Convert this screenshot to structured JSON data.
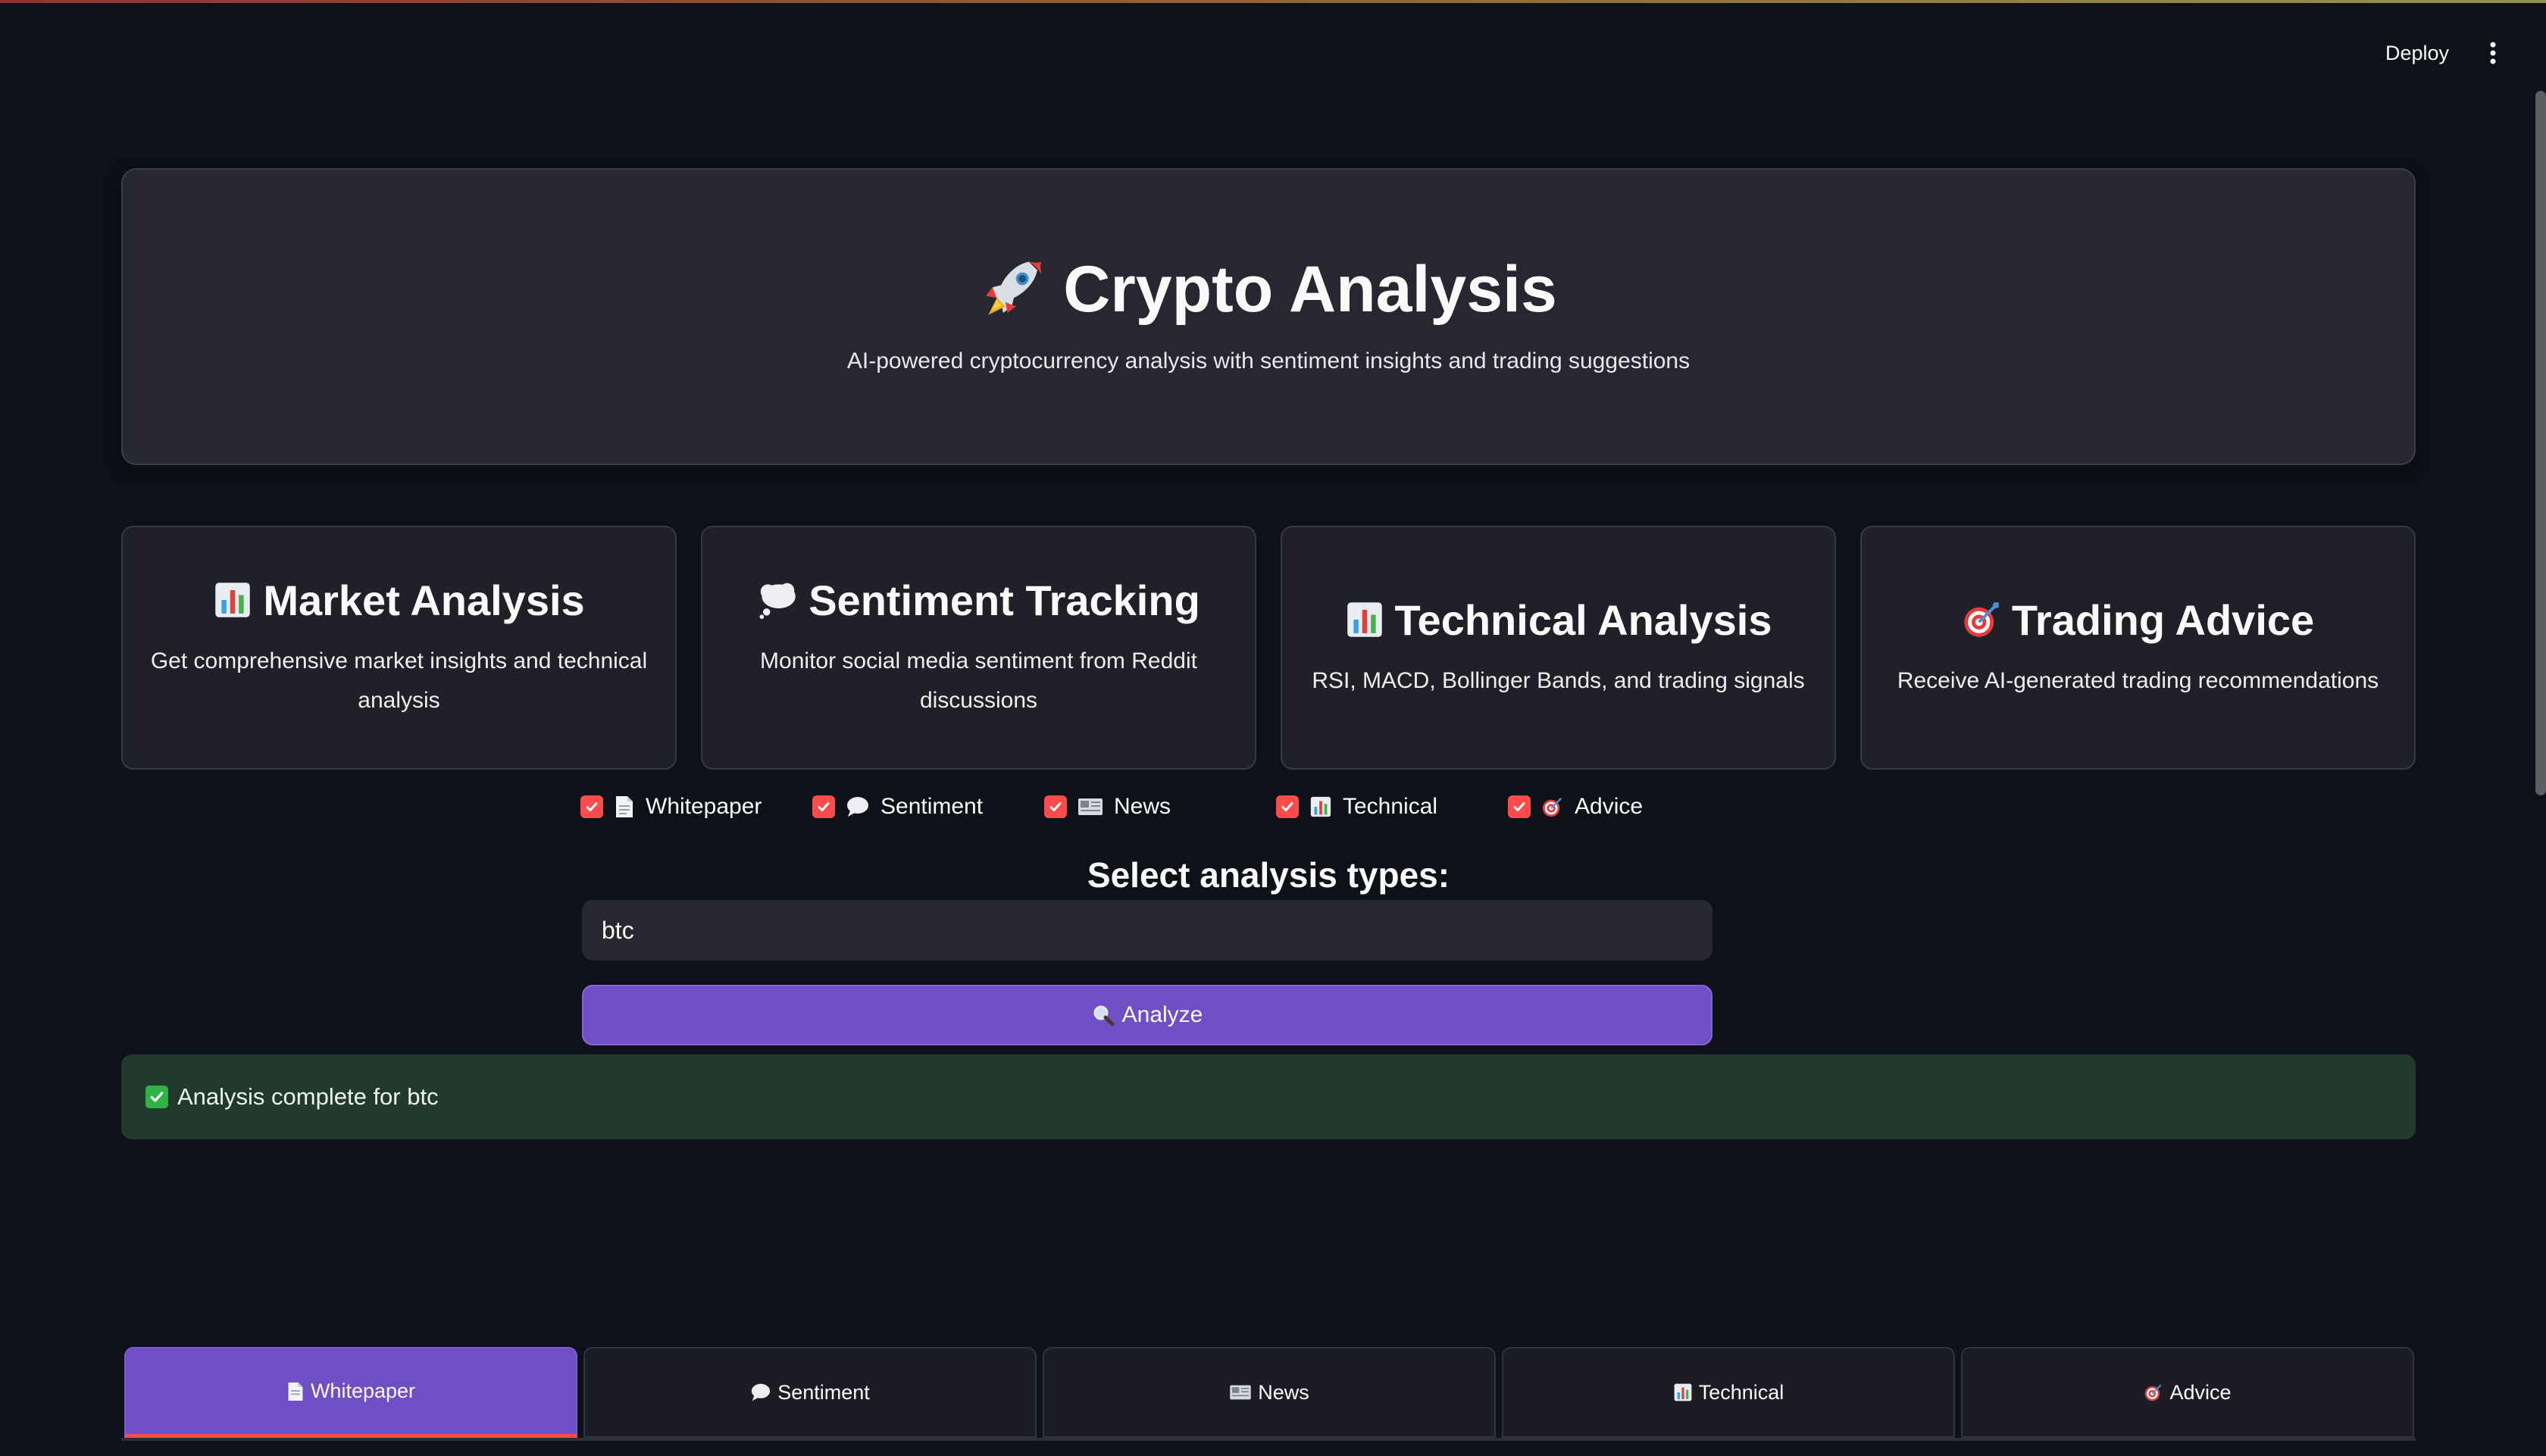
{
  "header": {
    "deploy_label": "Deploy"
  },
  "hero": {
    "title": "Crypto Analysis",
    "subtitle": "AI-powered cryptocurrency analysis with sentiment insights and trading suggestions",
    "icon": "rocket-icon"
  },
  "features": [
    {
      "icon": "bar-chart-icon",
      "title": "Market Analysis",
      "description": "Get comprehensive market insights and technical analysis"
    },
    {
      "icon": "thought-bubble-icon",
      "title": "Sentiment Tracking",
      "description": "Monitor social media sentiment from Reddit discussions"
    },
    {
      "icon": "bar-chart-icon",
      "title": "Technical Analysis",
      "description": "RSI, MACD, Bollinger Bands, and trading signals"
    },
    {
      "icon": "target-icon",
      "title": "Trading Advice",
      "description": "Receive AI-generated trading recommendations"
    }
  ],
  "analysis_types": {
    "heading": "Select analysis types:",
    "options": [
      {
        "label": "Whitepaper",
        "icon": "document-icon",
        "checked": true
      },
      {
        "label": "Sentiment",
        "icon": "speech-bubble-icon",
        "checked": true
      },
      {
        "label": "News",
        "icon": "newspaper-icon",
        "checked": true
      },
      {
        "label": "Technical",
        "icon": "bar-chart-icon",
        "checked": true
      },
      {
        "label": "Advice",
        "icon": "target-icon",
        "checked": true
      }
    ]
  },
  "search": {
    "value": "btc"
  },
  "analyze_button": {
    "label": "Analyze",
    "icon": "magnifier-icon"
  },
  "status": {
    "message": "Analysis complete for btc",
    "icon": "check-mark-icon"
  },
  "tabs": [
    {
      "label": "Whitepaper",
      "icon": "document-icon",
      "active": true
    },
    {
      "label": "Sentiment",
      "icon": "speech-bubble-icon",
      "active": false
    },
    {
      "label": "News",
      "icon": "newspaper-icon",
      "active": false
    },
    {
      "label": "Technical",
      "icon": "bar-chart-icon",
      "active": false
    },
    {
      "label": "Advice",
      "icon": "target-icon",
      "active": false
    }
  ],
  "colors": {
    "background": "#0e1117",
    "accent_primary": "#6f4fc6",
    "checkbox": "#ff4b4b",
    "success_bg": "#223a2c"
  }
}
